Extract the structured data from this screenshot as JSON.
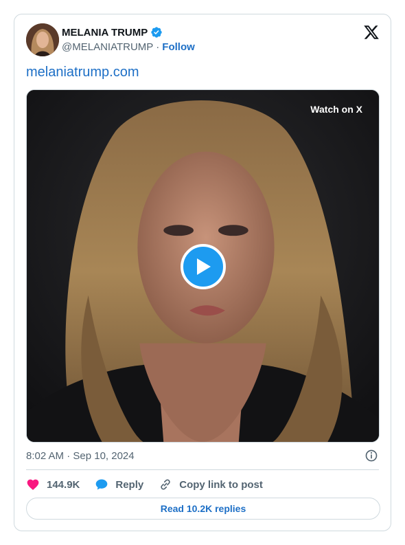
{
  "author": {
    "name": "MELANIA TRUMP",
    "handle": "@MELANIATRUMP",
    "separator": "·",
    "follow_label": "Follow"
  },
  "tweet": {
    "link_text": "melaniatrump.com",
    "watch_label": "Watch on X",
    "timestamp": "8:02 AM · Sep 10, 2024"
  },
  "actions": {
    "likes": "144.9K",
    "reply_label": "Reply",
    "copy_label": "Copy link to post"
  },
  "replies_label": "Read 10.2K replies",
  "colors": {
    "link": "#1d6fc6",
    "verified": "#1d9bf0",
    "like": "#f91880",
    "reply": "#1d9bf0",
    "muted": "#536471",
    "border": "#cfd9de"
  },
  "icons": [
    "verified-badge-icon",
    "x-logo-icon",
    "play-icon",
    "info-icon",
    "heart-icon",
    "reply-bubble-icon",
    "link-icon"
  ]
}
